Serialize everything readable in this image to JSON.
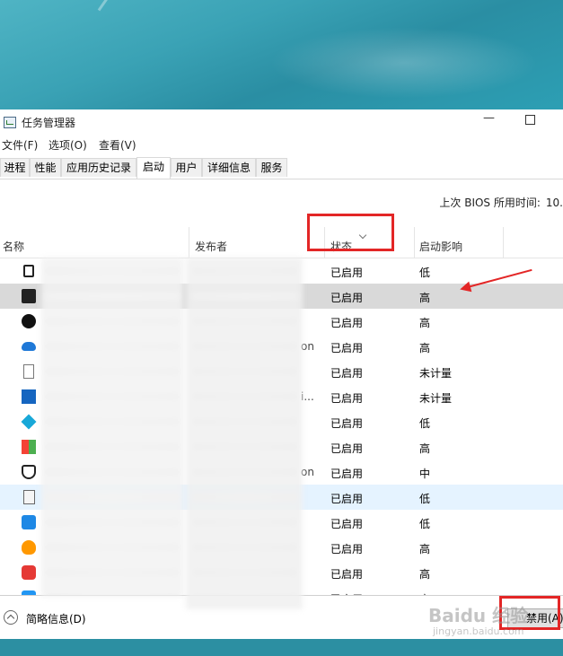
{
  "window": {
    "title": "任务管理器"
  },
  "menu": [
    "文件(F)",
    "选项(O)",
    "查看(V)"
  ],
  "tabs": [
    "进程",
    "性能",
    "应用历史记录",
    "启动",
    "用户",
    "详细信息",
    "服务"
  ],
  "active_tab": "启动",
  "bios": {
    "label": "上次 BIOS 所用时间:",
    "value": "10."
  },
  "columns": {
    "name": "名称",
    "publisher": "发布者",
    "status": "状态",
    "impact": "启动影响"
  },
  "rows": [
    {
      "icon": "app-icon",
      "pub_tail": "",
      "status": "已启用",
      "impact": "低"
    },
    {
      "icon": "epic-games-icon",
      "pub_tail": "",
      "status": "已启用",
      "impact": "高"
    },
    {
      "icon": "logitech-g-icon",
      "pub_tail": "",
      "status": "已启用",
      "impact": "高"
    },
    {
      "icon": "onedrive-icon",
      "pub_tail": "on",
      "status": "已启用",
      "impact": "高"
    },
    {
      "icon": "blank-file-icon",
      "pub_tail": "",
      "status": "已启用",
      "impact": "未计量"
    },
    {
      "icon": "red-x-app-icon",
      "pub_tail": "i...",
      "status": "已启用",
      "impact": "未计量"
    },
    {
      "icon": "cyan-app-icon",
      "pub_tail": "",
      "status": "已启用",
      "impact": "低"
    },
    {
      "icon": "colorful-grid-icon",
      "pub_tail": "",
      "status": "已启用",
      "impact": "高"
    },
    {
      "icon": "shield-icon",
      "pub_tail": "on",
      "status": "已启用",
      "impact": "中"
    },
    {
      "icon": "document-icon",
      "pub_tail": "",
      "status": "已启用",
      "impact": "低"
    },
    {
      "icon": "baidu-du-icon",
      "pub_tail": "",
      "status": "已启用",
      "impact": "低"
    },
    {
      "icon": "flame-icon",
      "pub_tail": "",
      "status": "已启用",
      "impact": "高"
    },
    {
      "icon": "red-app-icon",
      "pub_tail": "",
      "status": "已启用",
      "impact": "高"
    },
    {
      "icon": "blue-check-icon",
      "pub_tail": "",
      "status": "已启用",
      "impact": "高"
    }
  ],
  "footer": {
    "fewer_details": "简略信息(D)",
    "disable_button": "禁用(A)"
  },
  "watermark": {
    "main": "Baidu 经验",
    "sub": "jingyan.baidu.com"
  },
  "colors": {
    "annotation_red": "#e32626",
    "selected_row": "#d9d9d9",
    "hover_row": "#e5f3ff"
  }
}
